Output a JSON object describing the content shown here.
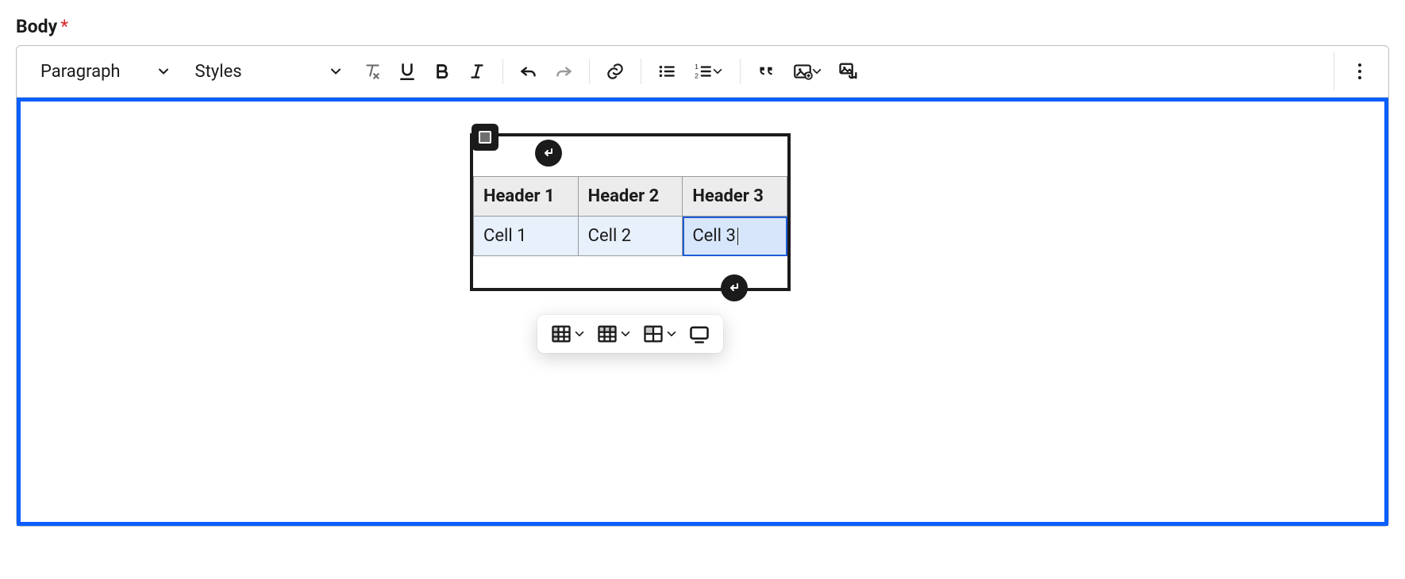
{
  "field": {
    "label": "Body",
    "required_marker": "*"
  },
  "toolbar": {
    "block_format": "Paragraph",
    "styles_label": "Styles"
  },
  "table": {
    "headers": [
      "Header 1",
      "Header 2",
      "Header 3"
    ],
    "cells": [
      "Cell 1",
      "Cell 2",
      "Cell 3"
    ],
    "active_cell_index": 2
  }
}
